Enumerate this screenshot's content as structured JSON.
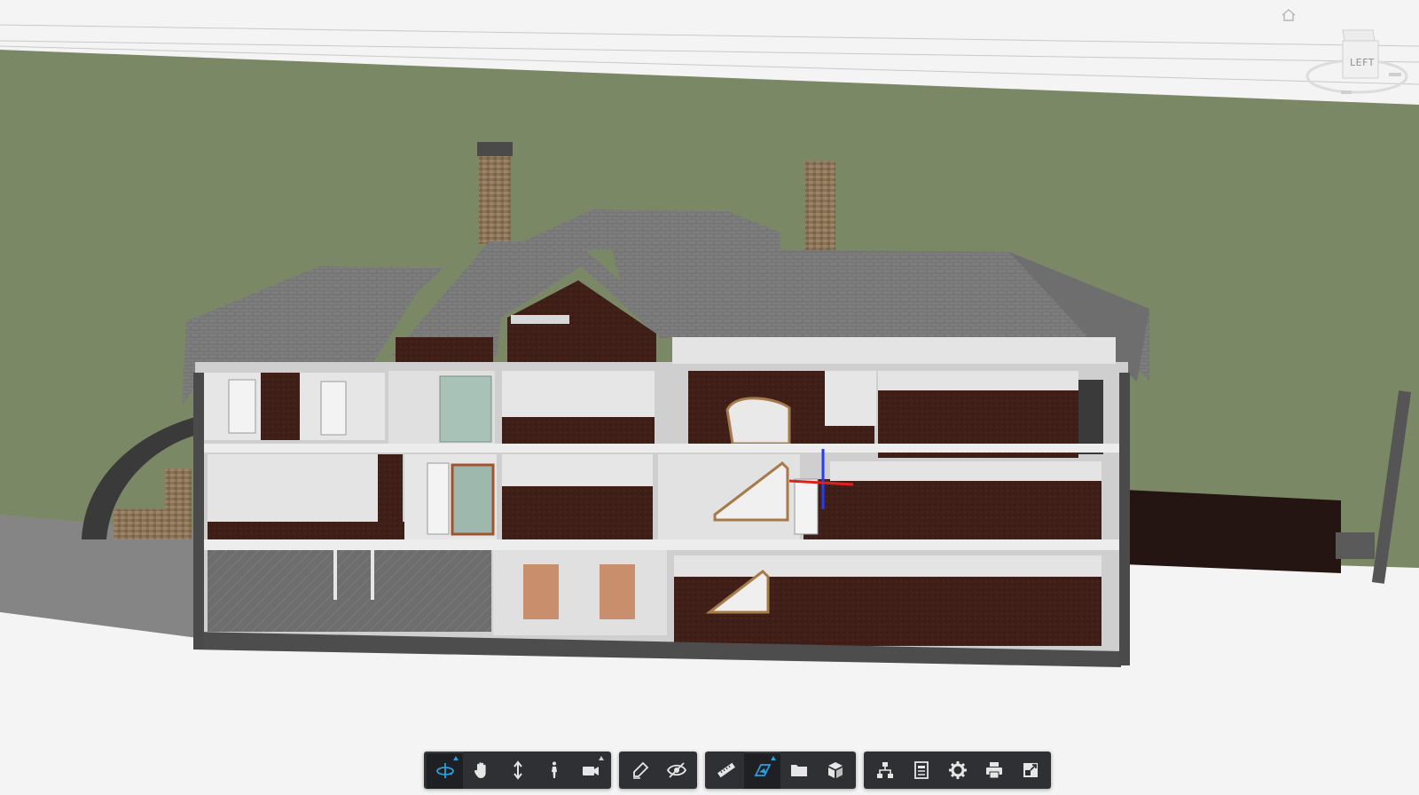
{
  "app": {
    "colors": {
      "toolbar_bg": "#2f3033",
      "icon": "#e6e6e6",
      "active_icon": "#2a9fe0",
      "sky": "#f4f4f4",
      "grass": "#7c8a66",
      "roof": "#7a7a7a",
      "wall": "#dcdcdc",
      "floor": "#3e1f18"
    }
  },
  "viewcube": {
    "face_label": "LEFT",
    "icon": "viewcube-icon"
  },
  "home": {
    "icon": "home-icon"
  },
  "toolbar": {
    "groups": [
      {
        "name": "navigation",
        "tools": [
          {
            "name": "orbit",
            "icon": "orbit-icon",
            "active": true,
            "flyout": true
          },
          {
            "name": "pan",
            "icon": "pan-hand-icon"
          },
          {
            "name": "zoom",
            "icon": "zoom-arrows-icon"
          },
          {
            "name": "first-person",
            "icon": "walk-person-icon"
          },
          {
            "name": "camera",
            "icon": "camera-icon",
            "flyout": true
          }
        ]
      },
      {
        "name": "markup",
        "tools": [
          {
            "name": "markup",
            "icon": "pen-icon"
          },
          {
            "name": "visibility",
            "icon": "eye-icon"
          }
        ]
      },
      {
        "name": "analysis",
        "tools": [
          {
            "name": "measure",
            "icon": "ruler-icon"
          },
          {
            "name": "section",
            "icon": "section-plane-icon",
            "active": true,
            "flyout": true
          },
          {
            "name": "browser",
            "icon": "folder-icon"
          },
          {
            "name": "explode",
            "icon": "cube-icon"
          }
        ]
      },
      {
        "name": "settings",
        "tools": [
          {
            "name": "model-browser",
            "icon": "hierarchy-icon"
          },
          {
            "name": "properties",
            "icon": "properties-icon"
          },
          {
            "name": "settings",
            "icon": "gear-icon"
          },
          {
            "name": "print",
            "icon": "print-icon"
          },
          {
            "name": "fullscreen",
            "icon": "fullscreen-icon"
          }
        ]
      }
    ]
  }
}
